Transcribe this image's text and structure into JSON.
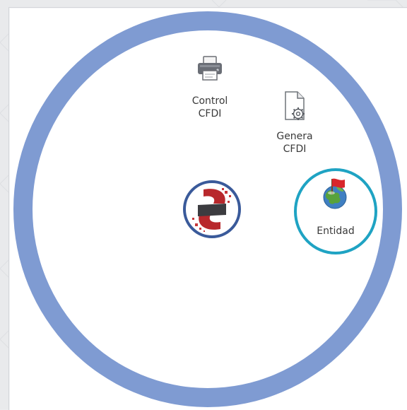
{
  "launcher": {
    "items": [
      {
        "id": "control-cfdi",
        "label_line1": "Control",
        "label_line2": "CFDI",
        "icon": "printer-icon"
      },
      {
        "id": "genera-cfdi",
        "label_line1": "Genera",
        "label_line2": "CFDI",
        "icon": "document-gear-icon"
      },
      {
        "id": "entidad",
        "label": "Entidad",
        "icon": "globe-flag-icon",
        "highlighted": true
      }
    ],
    "center_logo": {
      "icon": "app-logo-icon"
    }
  },
  "colors": {
    "ring": "#7f9bd2",
    "highlight": "#1fa3c3",
    "logo_ring": "#3a5a9a",
    "logo_red": "#b8282c"
  }
}
